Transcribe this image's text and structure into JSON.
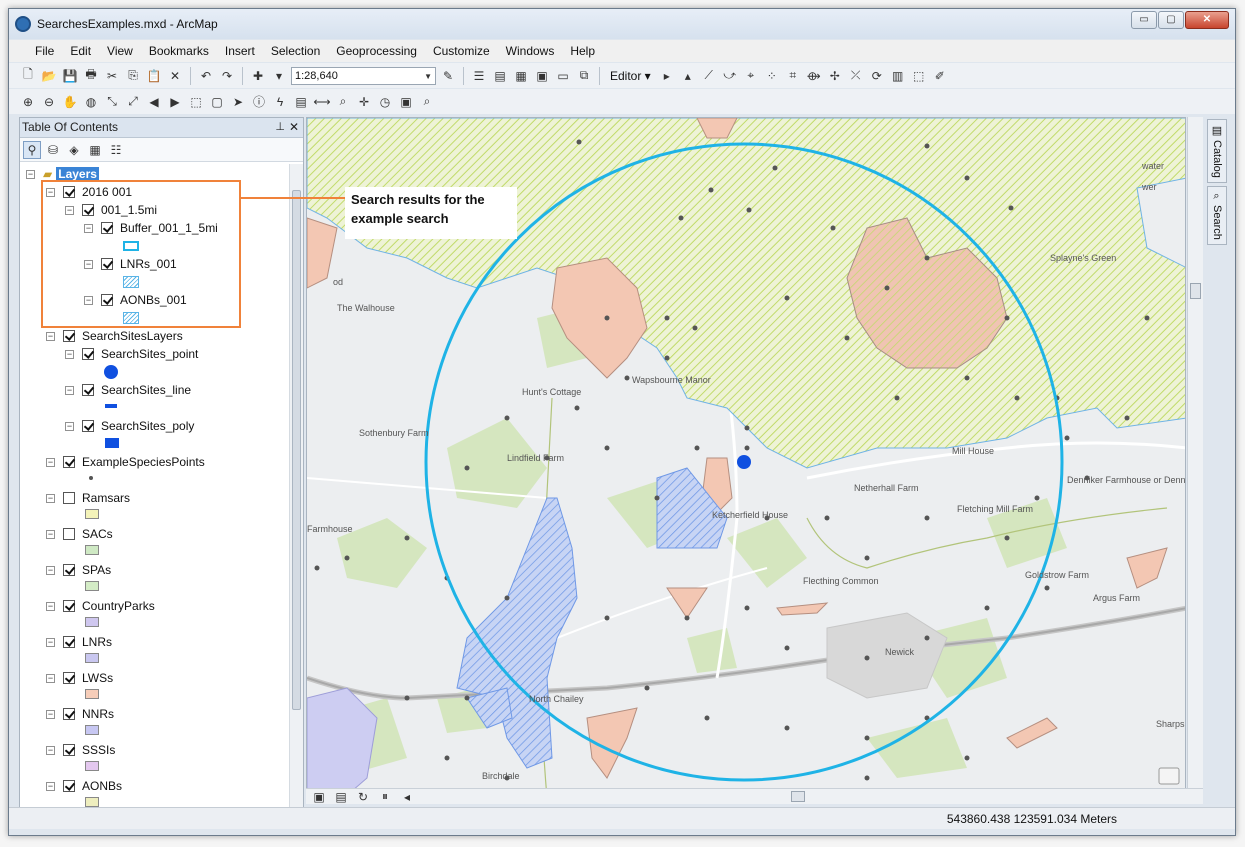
{
  "window": {
    "title": "SearchesExamples.mxd - ArcMap",
    "buttons": {
      "minimize": "▭",
      "maximize": "▢",
      "close": "✕"
    }
  },
  "menu": [
    "File",
    "Edit",
    "View",
    "Bookmarks",
    "Insert",
    "Selection",
    "Geoprocessing",
    "Customize",
    "Windows",
    "Help"
  ],
  "toolbar": {
    "scale": "1:28,640",
    "editor": "Editor ▾"
  },
  "toc": {
    "title": "Table Of Contents",
    "pin": "⊥",
    "close": "✕",
    "root": "Layers",
    "layers": [
      {
        "label": "2016 001",
        "checked": true
      },
      {
        "label": "001_1.5mi",
        "checked": true
      },
      {
        "label": "Buffer_001_1_5mi",
        "checked": true
      },
      {
        "label": "LNRs_001",
        "checked": true
      },
      {
        "label": "AONBs_001",
        "checked": true
      },
      {
        "label": "SearchSitesLayers",
        "checked": true
      },
      {
        "label": "SearchSites_point",
        "checked": true
      },
      {
        "label": "SearchSites_line",
        "checked": true
      },
      {
        "label": "SearchSites_poly",
        "checked": true
      },
      {
        "label": "ExampleSpeciesPoints",
        "checked": true
      },
      {
        "label": "Ramsars",
        "checked": false
      },
      {
        "label": "SACs",
        "checked": false
      },
      {
        "label": "SPAs",
        "checked": true
      },
      {
        "label": "CountryParks",
        "checked": true
      },
      {
        "label": "LNRs",
        "checked": true
      },
      {
        "label": "LWSs",
        "checked": true
      },
      {
        "label": "NNRs",
        "checked": true
      },
      {
        "label": "SSSIs",
        "checked": true
      },
      {
        "label": "AONBs",
        "checked": true
      }
    ],
    "swatch_colors": {
      "Ramsars": "#f4f3b9",
      "SACs": "#cfe9c4",
      "SPAs": "#d4ecc6",
      "CountryParks": "#cfc7ef",
      "LNRs": "#c9c7f0",
      "LWSs": "#f6cdb9",
      "NNRs": "#c7c7f2",
      "SSSIs": "#e4c8ef",
      "AONBs": "#eeeebe"
    }
  },
  "callout": {
    "text_line1": "Search results for the",
    "text_line2": "example search"
  },
  "map": {
    "labels": [
      "The Walhouse",
      "Hunt's Cottage",
      "Wapsbourne Manor",
      "Sothenbury Farm",
      "Lindfield Farm",
      "Farmhouse",
      "Netherhall Farm",
      "Fletching Mill Farm",
      "Mill House",
      "Flecthing Common",
      "Goldstrow Farm",
      "Argus Farm",
      "Newick",
      "North Chailey",
      "Birchdale",
      "Splayne's Green",
      "Denniker Farmhouse or Denniker Farm",
      "Sharps",
      "Ketcherfield House",
      "water",
      "wer",
      "od"
    ],
    "colors": {
      "buffer": "#1fb3e6",
      "aonb_hatch": "#c9e07a",
      "lnr_hatch": "#6fa8e8",
      "lws_fill": "#f3c7b3",
      "search_point": "#1050e0",
      "background": "#eceef0",
      "woodland": "#d5e6bf"
    }
  },
  "dock": {
    "catalog": "Catalog",
    "search": "Search"
  },
  "status": {
    "coordinates": "543860.438  123591.034 Meters"
  }
}
